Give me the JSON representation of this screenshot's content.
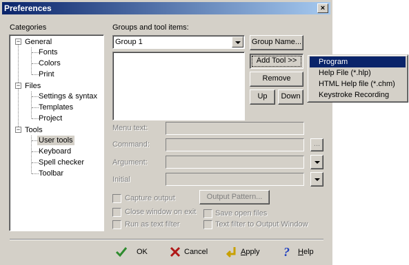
{
  "window": {
    "title": "Preferences",
    "close_label": "×"
  },
  "categories": {
    "label": "Categories",
    "tree": [
      {
        "label": "General",
        "expanded": true,
        "children": [
          "Fonts",
          "Colors",
          "Print"
        ]
      },
      {
        "label": "Files",
        "expanded": true,
        "children": [
          "Settings & syntax",
          "Templates",
          "Project"
        ]
      },
      {
        "label": "Tools",
        "expanded": true,
        "children": [
          "User tools",
          "Keyboard",
          "Spell checker",
          "Toolbar"
        ]
      }
    ],
    "selected": "User tools"
  },
  "groups": {
    "label": "Groups and tool items:",
    "selected_group": "Group 1",
    "group_name_button": "Group Name...",
    "add_tool_button": "Add Tool >>",
    "remove_button": "Remove",
    "up_button": "Up",
    "down_button": "Down"
  },
  "fields": {
    "menu_text_label": "Menu text:",
    "command_label": "Command:",
    "argument_label": "Argument:",
    "initial_label": "Initial",
    "browse_button": "...",
    "output_pattern_button": "Output Pattern..."
  },
  "options": {
    "capture_output": "Capture output",
    "close_window": "Close window on exit",
    "save_open_files": "Save open files",
    "run_as_text_filter": "Run as text filter",
    "text_filter_output": "Text filter to Output Window"
  },
  "add_tool_menu": {
    "items": [
      "Program",
      "Help File (*.hlp)",
      "HTML Help file (*.chm)",
      "Keystroke Recording"
    ],
    "highlighted": "Program"
  },
  "footer": {
    "ok": "OK",
    "cancel": "Cancel",
    "apply": "Apply",
    "help": "Help"
  },
  "colors": {
    "title_start": "#0a246a",
    "title_end": "#a6caf0",
    "dialog_bg": "#d4d0c8",
    "highlight": "#0a246a",
    "ok_icon": "#2e8b2e",
    "cancel_icon": "#b01818",
    "apply_icon": "#c8a000",
    "help_icon": "#1f3fbf"
  }
}
